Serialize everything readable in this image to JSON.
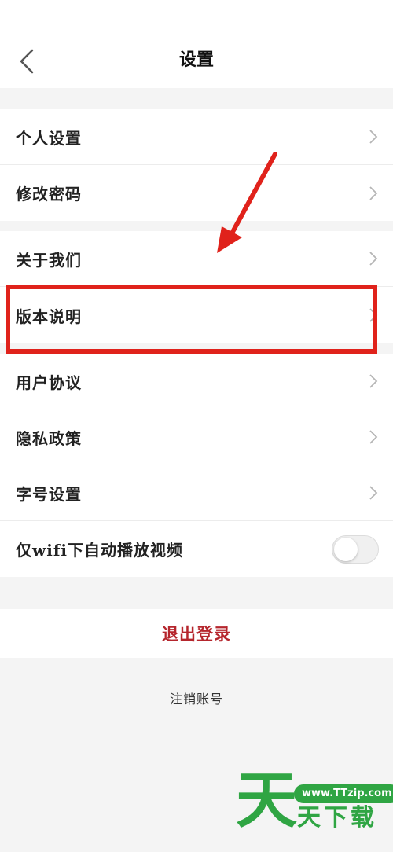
{
  "header": {
    "title": "设置",
    "back_icon": "chevron-left-icon"
  },
  "groups": [
    {
      "items": [
        {
          "label": "个人设置"
        },
        {
          "label": "修改密码"
        }
      ]
    },
    {
      "items": [
        {
          "label": "关于我们"
        },
        {
          "label": "版本说明"
        }
      ]
    },
    {
      "items": [
        {
          "label": "用户协议"
        },
        {
          "label": "隐私政策"
        },
        {
          "label": "字号设置"
        }
      ]
    }
  ],
  "autoplay": {
    "label": "仅wifi下自动播放视频",
    "enabled": false
  },
  "logout": {
    "label": "退出登录"
  },
  "cancel_account": {
    "label": "注销账号"
  },
  "watermark": {
    "big": "天",
    "url": "www.TTzip.com",
    "small": "天下载"
  },
  "colors": {
    "highlight": "#e0221b",
    "logout": "#b5262d",
    "watermark": "#2fa543"
  }
}
